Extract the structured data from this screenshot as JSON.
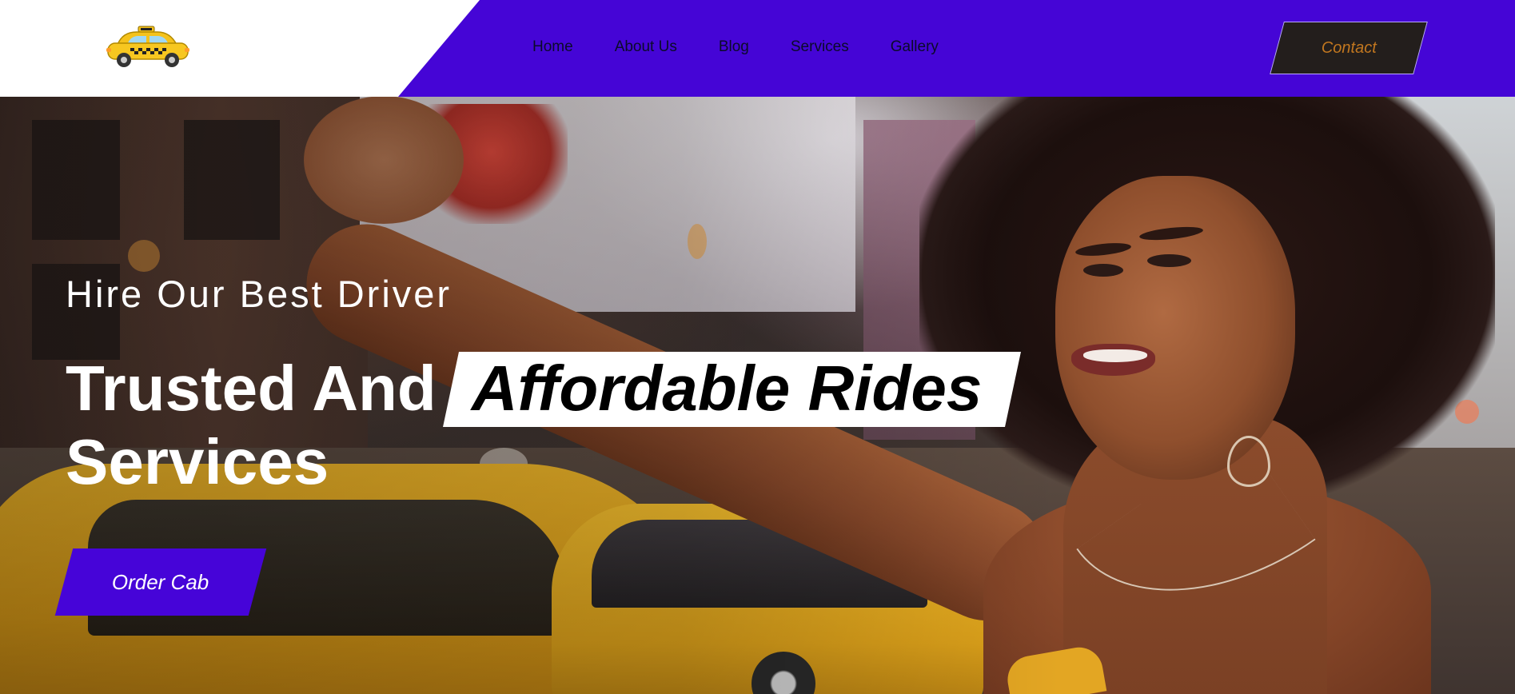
{
  "header": {
    "logo_icon": "taxi-car-icon",
    "nav": [
      {
        "label": "Home"
      },
      {
        "label": "About Us"
      },
      {
        "label": "Blog"
      },
      {
        "label": "Services"
      },
      {
        "label": "Gallery"
      }
    ],
    "contact_label": "Contact"
  },
  "hero": {
    "subtitle": "Hire Our Best Driver",
    "headline_part1": "Trusted And",
    "headline_highlight": "Affordable Rides",
    "headline_part2": "Services",
    "cta_label": "Order Cab",
    "background_image": "woman-hailing-taxi-photo"
  },
  "colors": {
    "accent_purple": "#4505d6",
    "contact_bg": "#231e1c",
    "contact_text": "#c2771f",
    "highlight_bg": "#ffffff",
    "text_white": "#ffffff"
  }
}
